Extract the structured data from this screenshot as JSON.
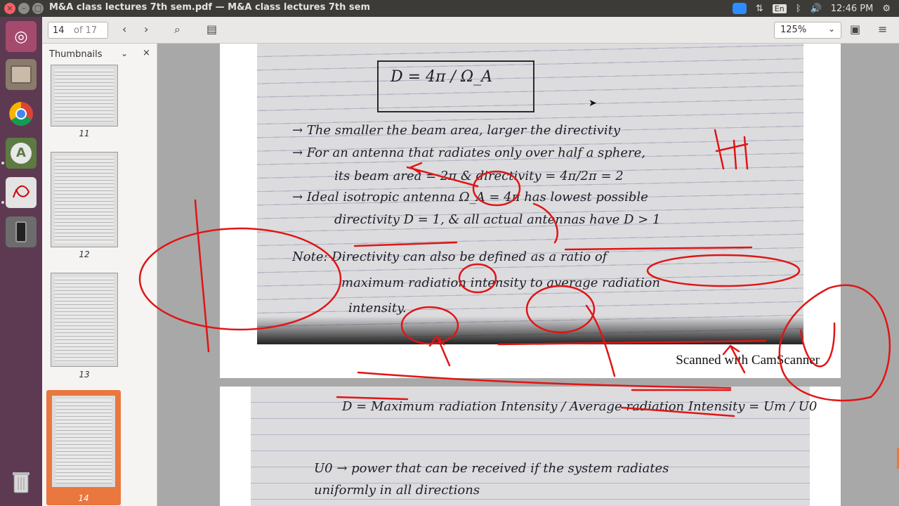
{
  "window": {
    "title": "M&A class lectures 7th sem.pdf — M&A class lectures 7th sem"
  },
  "indicators": {
    "lang": "En",
    "time": "12:46 PM"
  },
  "toolbar": {
    "page_current": "14",
    "page_total": "of 17",
    "zoom": "125%"
  },
  "sidebar": {
    "title": "Thumbnails",
    "thumbnails": [
      {
        "label": "11"
      },
      {
        "label": "12"
      },
      {
        "label": "13"
      },
      {
        "label": "14",
        "selected": true
      }
    ]
  },
  "document": {
    "page1": {
      "lines": [
        "D  =  4π / Ω_A",
        "→ The smaller the beam area, larger the directivity",
        "→ For an antenna that radiates only over half a sphere,",
        "its beam area = 2π & directivity = 4π/2π = 2",
        "→ Ideal isotropic antenna Ω_A = 4π has lowest possible",
        "directivity D = 1, & all actual antennas have D > 1",
        "Note: Directivity can also be defined as a ratio of",
        "maximum radiation intensity to average radiation",
        "intensity."
      ],
      "scan_label": "Scanned with CamScanner"
    },
    "page2": {
      "lines": [
        "D = Maximum radiation Intensity / Average radiation Intensity = Um / U0",
        "U0 → power that can be received if the system radiates",
        "uniformly in all directions"
      ]
    }
  },
  "colors": {
    "accent": "#e9773e",
    "annotation": "#e01515",
    "topbar": "#3c3b37",
    "launcher": "#5d3a52"
  }
}
